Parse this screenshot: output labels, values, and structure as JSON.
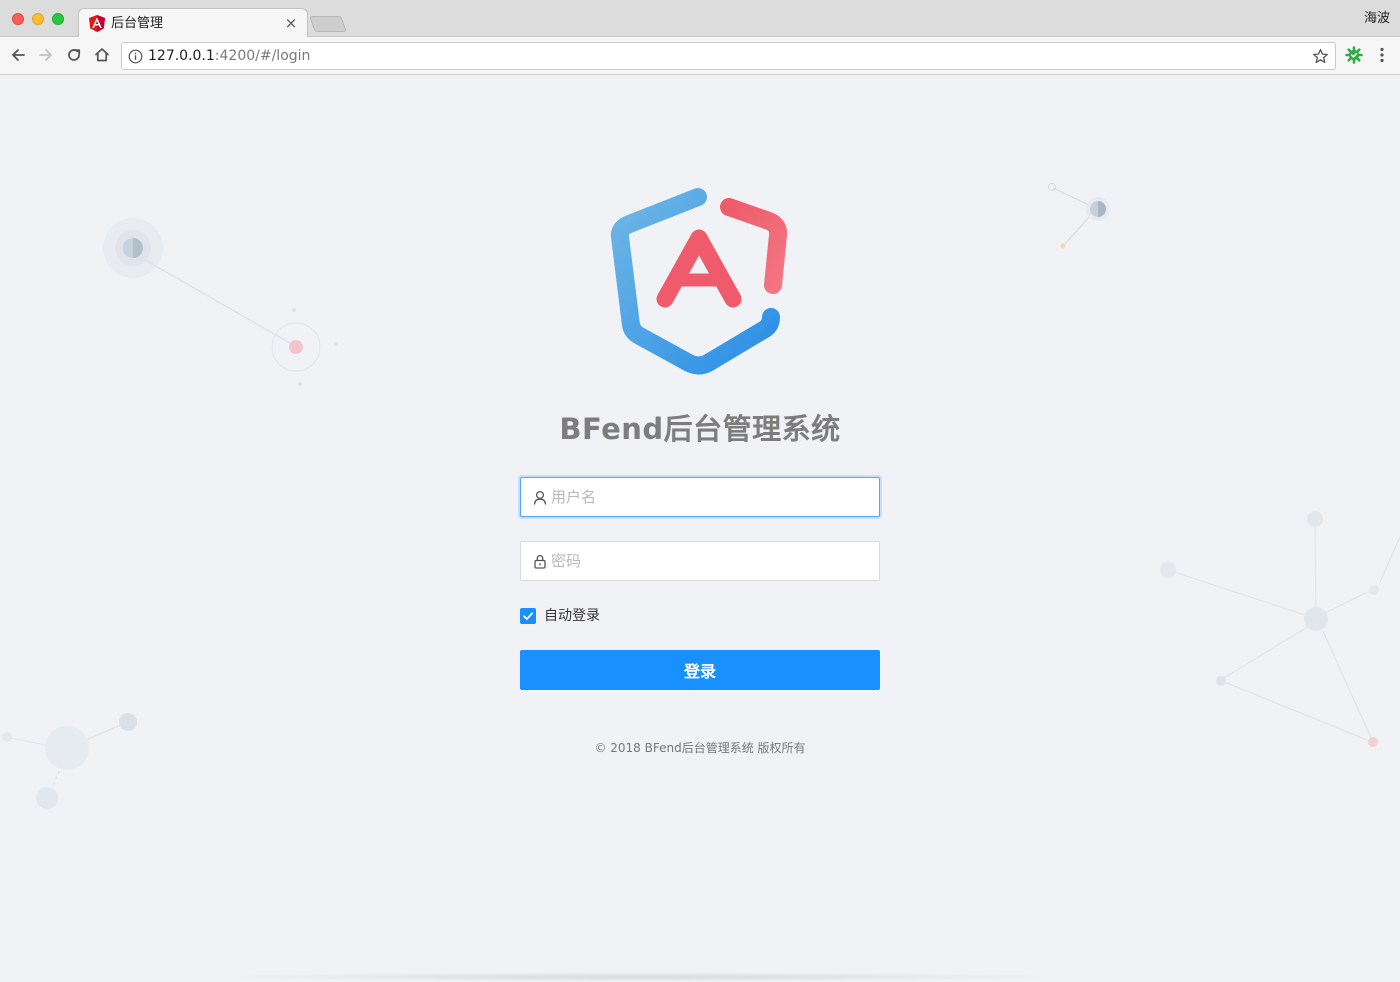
{
  "browser": {
    "tab": {
      "title": "后台管理",
      "close_glyph": "×",
      "favicon": "angular-icon"
    },
    "profile_name": "海波",
    "address": {
      "host": "127.0.0.1",
      "path": ":4200/#/login"
    },
    "toolbar_icons": [
      "back-icon",
      "forward-icon",
      "reload-icon",
      "home-icon",
      "info-icon",
      "star-icon",
      "extension-icon",
      "menu-icon"
    ]
  },
  "page": {
    "title": "BFend后台管理系统",
    "logo": "angular-shield-logo",
    "colors": {
      "primary": "#1890ff",
      "logo_blue": "#4a9fe0",
      "logo_red": "#ef5b6a",
      "background": "#f0f2f5"
    }
  },
  "form": {
    "username": {
      "placeholder": "用户名",
      "value": "",
      "icon": "user-icon",
      "focused": true
    },
    "password": {
      "placeholder": "密码",
      "value": "",
      "icon": "lock-icon"
    },
    "remember": {
      "label": "自动登录",
      "checked": true
    },
    "submit_label": "登录"
  },
  "footer": {
    "copyright": "© 2018 BFend后台管理系统 版权所有"
  }
}
